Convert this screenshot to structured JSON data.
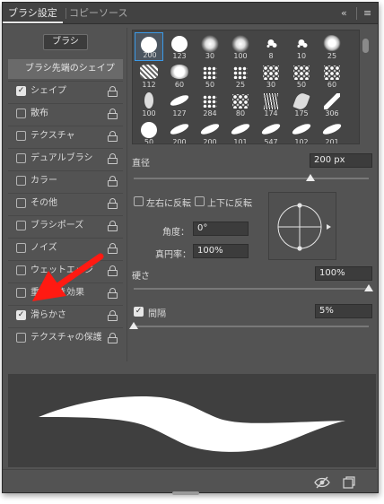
{
  "tabs": [
    {
      "label": "ブラシ設定",
      "active": true
    },
    {
      "label": "コピーソース",
      "active": false
    }
  ],
  "toolbar_icons": {
    "collapse": "«",
    "menu": "≡"
  },
  "brushes_button": "ブラシ",
  "tip_shape_label": "ブラシ先端のシェイプ",
  "options": [
    {
      "label": "シェイプ",
      "checked": true
    },
    {
      "label": "散布",
      "checked": false
    },
    {
      "label": "テクスチャ",
      "checked": false
    },
    {
      "label": "デュアルブラシ",
      "checked": false
    },
    {
      "label": "カラー",
      "checked": false
    },
    {
      "label": "その他",
      "checked": false
    },
    {
      "label": "ブラシポーズ",
      "checked": false
    },
    {
      "label": "ノイズ",
      "checked": false
    },
    {
      "label": "ウェットエッジ",
      "checked": false
    },
    {
      "label": "重ね描き効果",
      "checked": false
    },
    {
      "label": "滑らかさ",
      "checked": true
    },
    {
      "label": "テクスチャの保護",
      "checked": false
    }
  ],
  "brush_presets": [
    {
      "size": "200",
      "kind": "hard-round",
      "selected": true
    },
    {
      "size": "123",
      "kind": "hard-round"
    },
    {
      "size": "30",
      "kind": "soft-round"
    },
    {
      "size": "100",
      "kind": "soft-round"
    },
    {
      "size": "8",
      "kind": "splatter"
    },
    {
      "size": "10",
      "kind": "splatter"
    },
    {
      "size": "25",
      "kind": "spatter-large"
    },
    {
      "size": "112",
      "kind": "textured"
    },
    {
      "size": "60",
      "kind": "chalk"
    },
    {
      "size": "50",
      "kind": "dots"
    },
    {
      "size": "25",
      "kind": "dots"
    },
    {
      "size": "30",
      "kind": "spatter"
    },
    {
      "size": "50",
      "kind": "spatter"
    },
    {
      "size": "60",
      "kind": "spatter"
    },
    {
      "size": "100",
      "kind": "bristle"
    },
    {
      "size": "127",
      "kind": "stroke"
    },
    {
      "size": "284",
      "kind": "dots"
    },
    {
      "size": "80",
      "kind": "spatter"
    },
    {
      "size": "174",
      "kind": "grass"
    },
    {
      "size": "175",
      "kind": "leaf"
    },
    {
      "size": "306",
      "kind": "scatter"
    },
    {
      "size": "50",
      "kind": "hard-round"
    },
    {
      "size": "200",
      "kind": "stroke"
    },
    {
      "size": "200",
      "kind": "stroke"
    },
    {
      "size": "101",
      "kind": "stroke"
    },
    {
      "size": "547",
      "kind": "stroke"
    },
    {
      "size": "102",
      "kind": "stroke"
    },
    {
      "size": "201",
      "kind": "stroke"
    }
  ],
  "diameter": {
    "label": "直径",
    "value": "200 px",
    "fraction": 0.75
  },
  "flip_x": {
    "label": "左右に反転",
    "checked": false
  },
  "flip_y": {
    "label": "上下に反転",
    "checked": false
  },
  "angle": {
    "label": "角度：",
    "value": "0°"
  },
  "roundness": {
    "label": "真円率：",
    "value": "100%"
  },
  "hardness": {
    "label": "硬さ",
    "value": "100%",
    "fraction": 1.0
  },
  "spacing": {
    "label": "間隔",
    "value": "5%",
    "checked": true,
    "fraction": 0.0
  },
  "colors": {
    "panel": "#535353",
    "selection": "#3b9ae8",
    "arrow": "#ff1a12"
  },
  "bottom_icons": [
    "eye-slash-icon",
    "new-preset-icon"
  ]
}
